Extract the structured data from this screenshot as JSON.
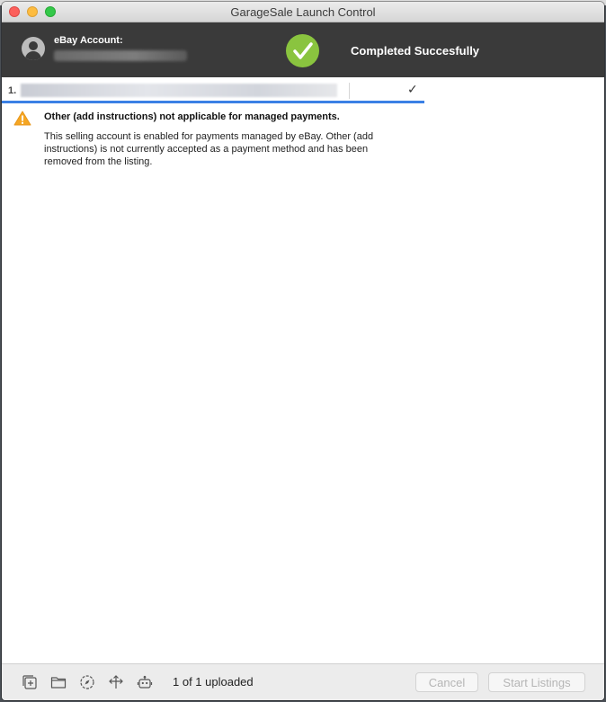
{
  "window": {
    "title": "GarageSale Launch Control"
  },
  "header": {
    "account_label": "eBay Account:",
    "account_value": "",
    "status_text": "Completed Succesfully",
    "status_color": "#8ac43f",
    "background": "#3a3a3a"
  },
  "listings": [
    {
      "number": "1.",
      "title": "",
      "status_icon": "checkmark-icon"
    }
  ],
  "message": {
    "icon": "warning-icon",
    "icon_color": "#f5a623",
    "title": "Other (add instructions) not applicable for managed payments.",
    "body": "This selling account is enabled for payments managed by eBay. Other (add instructions) is not currently accepted as a payment method and has been removed from the listing."
  },
  "toolbar": {
    "icons": [
      "add-icon",
      "folder-icon",
      "compass-icon",
      "move-icon",
      "robot-icon"
    ],
    "upload_status": "1 of 1 uploaded",
    "cancel_label": "Cancel",
    "start_label": "Start Listings"
  },
  "colors": {
    "selection_accent": "#3b80e5"
  }
}
